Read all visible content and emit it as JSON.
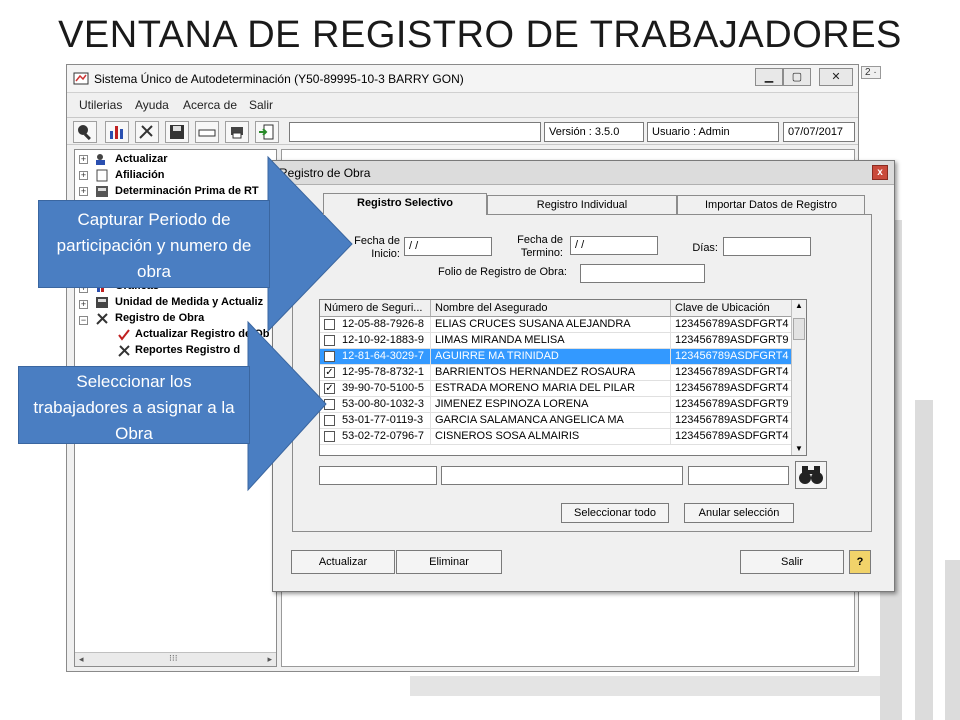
{
  "slide_title": "VENTANA DE REGISTRO DE TRABAJADORES",
  "main_window": {
    "title": "Sistema Único de Autodeterminación (Y50-89995-10-3  BARRY GON)",
    "menu": [
      "Utilerias",
      "Ayuda",
      "Acerca de",
      "Salir"
    ],
    "status": {
      "version": "Versión : 3.5.0",
      "user": "Usuario : Admin",
      "date": "07/07/2017"
    },
    "tree_items": [
      "Actualizar",
      "Afiliación",
      "Determinación Prima de RT",
      "Gráficas",
      "Unidad de Medida y Actualiz",
      "Registro de Obra",
      "Actualizar Registro de Ob",
      "Reportes Registro d"
    ],
    "corner_label": "2 ·"
  },
  "dialog": {
    "title": "Registro de Obra",
    "close_glyph": "x",
    "tabs": [
      "Registro Selectivo",
      "Registro Individual",
      "Importar Datos de Registro"
    ],
    "active_tab": 0,
    "fields": {
      "fecha_inicio_label": "Fecha de Inicio:",
      "fecha_inicio_value": "/ /",
      "fecha_termino_label": "Fecha de Termino:",
      "fecha_termino_value": "/ /",
      "dias_label": "Días:",
      "dias_value": "",
      "folio_label": "Folio de Registro de Obra:",
      "folio_value": ""
    },
    "grid": {
      "columns": [
        "Número de Seguri...",
        "Nombre del Asegurado",
        "Clave de Ubicación"
      ],
      "rows": [
        {
          "checked": false,
          "nss": "12-05-88-7926-8",
          "name": "ELIAS CRUCES SUSANA ALEJANDRA",
          "clave": "123456789ASDFGRT4",
          "selected": false
        },
        {
          "checked": false,
          "nss": "12-10-92-1883-9",
          "name": "LIMAS MIRANDA MELISA",
          "clave": "123456789ASDFGRT9",
          "selected": false
        },
        {
          "checked": false,
          "nss": "12-81-64-3029-7",
          "name": "AGUIRRE  MA TRINIDAD",
          "clave": "123456789ASDFGRT4",
          "selected": true
        },
        {
          "checked": true,
          "nss": "12-95-78-8732-1",
          "name": "BARRIENTOS HERNANDEZ ROSAURA",
          "clave": "123456789ASDFGRT4",
          "selected": false
        },
        {
          "checked": true,
          "nss": "39-90-70-5100-5",
          "name": "ESTRADA MORENO MARIA DEL PILAR",
          "clave": "123456789ASDFGRT4",
          "selected": false
        },
        {
          "checked": false,
          "nss": "53-00-80-1032-3",
          "name": "JIMENEZ ESPINOZA LORENA",
          "clave": "123456789ASDFGRT9",
          "selected": false
        },
        {
          "checked": false,
          "nss": "53-01-77-0119-3",
          "name": "GARCIA SALAMANCA ANGELICA MA",
          "clave": "123456789ASDFGRT4",
          "selected": false
        },
        {
          "checked": false,
          "nss": "53-02-72-0796-7",
          "name": "CISNEROS SOSA ALMAIRIS",
          "clave": "123456789ASDFGRT4",
          "selected": false
        }
      ]
    },
    "buttons": {
      "select_all": "Seleccionar todo",
      "clear_selection": "Anular selección",
      "update": "Actualizar",
      "delete": "Eliminar",
      "exit": "Salir",
      "help": "?"
    }
  },
  "callouts": [
    "Capturar Periodo de participación y numero de obra",
    "Seleccionar los trabajadores a asignar a  la Obra"
  ],
  "colors": {
    "callout": "#4a7ec2",
    "selection": "#3399ff"
  }
}
